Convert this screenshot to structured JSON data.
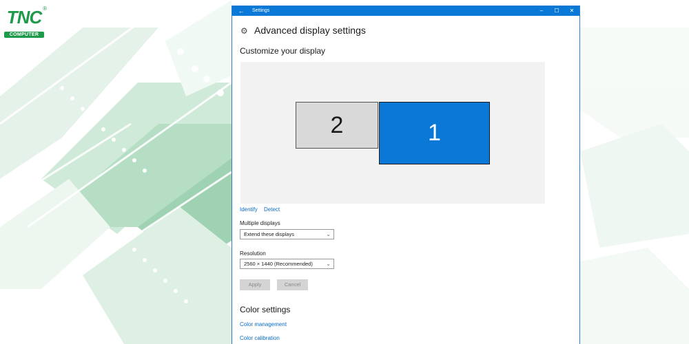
{
  "logo": {
    "text": "TNC",
    "sub": "COMPUTER",
    "reg": "®"
  },
  "window": {
    "title": "Settings",
    "back_icon": "←",
    "min_icon": "–",
    "max_icon": "☐",
    "close_icon": "✕"
  },
  "page": {
    "title": "Advanced display settings",
    "gear_icon": "⚙",
    "subtitle": "Customize your display"
  },
  "monitors": [
    {
      "label": "2",
      "selected": false
    },
    {
      "label": "1",
      "selected": true
    }
  ],
  "links": {
    "identify": "Identify",
    "detect": "Detect"
  },
  "multiple_displays": {
    "label": "Multiple displays",
    "value": "Extend these displays"
  },
  "resolution": {
    "label": "Resolution",
    "value": "2560 × 1440 (Recommended)"
  },
  "buttons": {
    "apply": "Apply",
    "cancel": "Cancel"
  },
  "color_settings": {
    "title": "Color settings",
    "management": "Color management",
    "calibration": "Color calibration"
  },
  "colors": {
    "accent": "#0a78d7",
    "brand_green": "#1d9a4a"
  }
}
